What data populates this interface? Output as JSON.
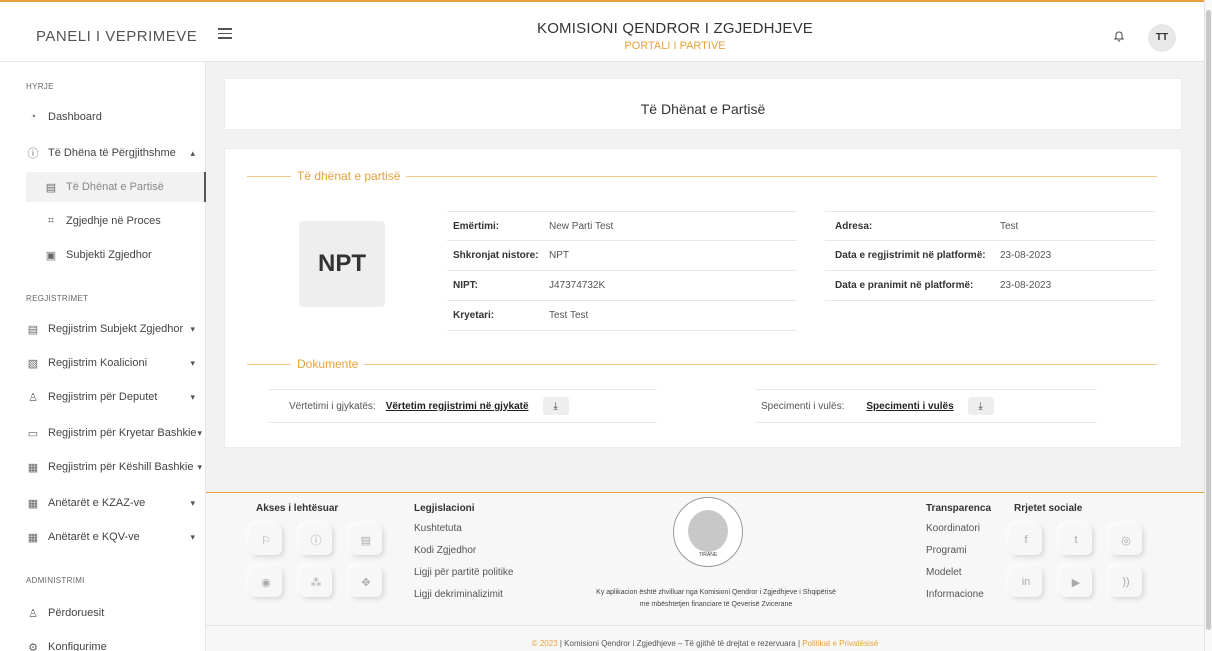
{
  "header": {
    "brand": "PANELI I VEPRIMEVE",
    "title": "KOMISIONI QENDROR I ZGJEDHJEVE",
    "subtitle": "PORTALI I PARTIVE",
    "avatar_initials": "TT",
    "accent_color": "#e8a23c"
  },
  "sidebar": {
    "sections": [
      "HYRJE",
      "REGJISTRIMET",
      "ADMINISTRIMI"
    ],
    "items": [
      {
        "label": "Dashboard",
        "icon": "dashboard-icon"
      },
      {
        "label": "Të Dhëna të Përgjithshme",
        "icon": "info-icon"
      },
      {
        "label": "Të Dhënat e Partisë",
        "icon": "document-icon"
      },
      {
        "label": "Zgjedhje në Proces",
        "icon": "process-icon"
      },
      {
        "label": "Subjekti Zgjedhor",
        "icon": "subject-icon"
      },
      {
        "label": "Regjistrim Subjekt Zgjedhor",
        "icon": "register-icon"
      },
      {
        "label": "Regjistrim Koalicioni",
        "icon": "coalition-icon"
      },
      {
        "label": "Regjistrim për Deputet",
        "icon": "user-icon"
      },
      {
        "label": "Regjistrim për Kryetar Bashkie",
        "icon": "id-card-icon"
      },
      {
        "label": "Regjistrim për Këshill Bashkie",
        "icon": "building-icon"
      },
      {
        "label": "Anëtarët e KZAZ-ve",
        "icon": "building-icon"
      },
      {
        "label": "Anëtarët e KQV-ve",
        "icon": "building-icon"
      },
      {
        "label": "Përdoruesit",
        "icon": "users-icon"
      },
      {
        "label": "Konfigurime",
        "icon": "settings-icon"
      }
    ]
  },
  "page": {
    "title": "Të Dhënat e Partisë",
    "section_party": "Të dhënat e partisë",
    "section_docs": "Dokumente",
    "logo_text": "NPT"
  },
  "party": {
    "fields_left": [
      {
        "label": "Emërtimi:",
        "value": "New Parti Test"
      },
      {
        "label": "Shkronjat nistore:",
        "value": "NPT"
      },
      {
        "label": "NIPT:",
        "value": "J47374732K"
      },
      {
        "label": "Kryetari:",
        "value": "Test Test"
      }
    ],
    "fields_right": [
      {
        "label": "Adresa:",
        "value": "Test"
      },
      {
        "label": "Data e regjistrimit në platformë:",
        "value": "23-08-2023"
      },
      {
        "label": "Data e pranimit në platformë:",
        "value": "23-08-2023"
      }
    ]
  },
  "documents": [
    {
      "label": "Vërtetimi i gjykatës:",
      "link": "Vërtetim regjistrimi në gjykatë",
      "download_icon": "download-icon"
    },
    {
      "label": "Specimenti i vulës:",
      "link": "Specimenti i vulës",
      "download_icon": "download-icon"
    }
  ],
  "footer": {
    "access_title": "Akses i lehtësuar",
    "legislation_title": "Legjislacioni",
    "legislation_links": [
      "Kushtetuta",
      "Kodi Zgjedhor",
      "Ligji për partitë politike",
      "Ligji dekriminalizimit"
    ],
    "transparency_title": "Transparenca",
    "transparency_links": [
      "Koordinatori",
      "Programi",
      "Modelet",
      "Informacione"
    ],
    "social_title": "Rrjetet sociale",
    "seal_text": "TIRANE",
    "note_line1": "Ky aplikacion është zhvilluar nga Komisioni Qendror i Zgjedhjeve i Shqipërisë",
    "note_line2": "me mbështetjen financiare të Qeverisë Zvicerane",
    "copyright": "© 2023",
    "rights": "Komisioni Qendror i Zgjedhjeve – Të gjithë të drejtat e rezervuara",
    "privacy": "Politikat e Privatësisë"
  }
}
